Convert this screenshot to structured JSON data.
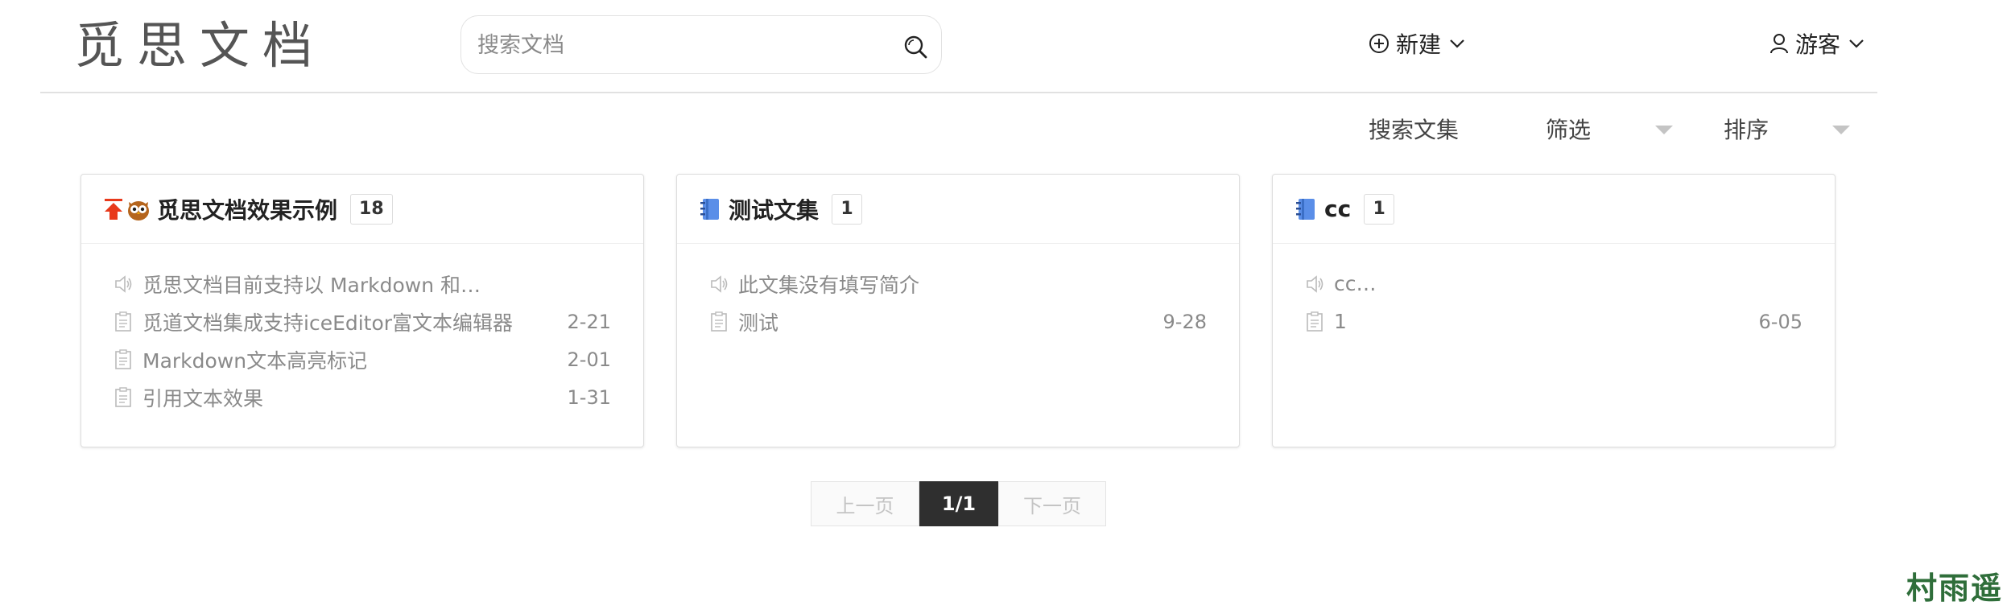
{
  "header": {
    "logo": "觅思文档",
    "search": {
      "placeholder": "搜索文档",
      "value": ""
    },
    "new_label": "新建",
    "user_label": "游客"
  },
  "toolbar": {
    "search_collection": "搜索文集",
    "filter": "筛选",
    "sort": "排序"
  },
  "collections": [
    {
      "title": "觅思文档效果示例",
      "count": "18",
      "pinned": true,
      "icon": "owl-emoji-icon",
      "intro": "觅思文档目前支持以 Markdown 和…",
      "docs": [
        {
          "title": "觅道文档集成支持iceEditor富文本编辑器",
          "date": "2-21"
        },
        {
          "title": "Markdown文本高亮标记",
          "date": "2-01"
        },
        {
          "title": "引用文本效果",
          "date": "1-31"
        }
      ]
    },
    {
      "title": "测试文集",
      "count": "1",
      "pinned": false,
      "icon": "notebook-icon",
      "intro": "此文集没有填写简介",
      "docs": [
        {
          "title": "测试",
          "date": "9-28"
        }
      ]
    },
    {
      "title": "cc",
      "count": "1",
      "pinned": false,
      "icon": "notebook-icon",
      "intro": "cc…",
      "docs": [
        {
          "title": "1",
          "date": "6-05"
        }
      ]
    }
  ],
  "pagination": {
    "prev": "上一页",
    "current": "1/1",
    "next": "下一页"
  },
  "watermark": "村雨遥",
  "colors": {
    "pin_arrow": "#e8391b",
    "notebook": "#5a8ee8",
    "pager_active": "#2f2f2f",
    "watermark": "#2f6e3a"
  }
}
